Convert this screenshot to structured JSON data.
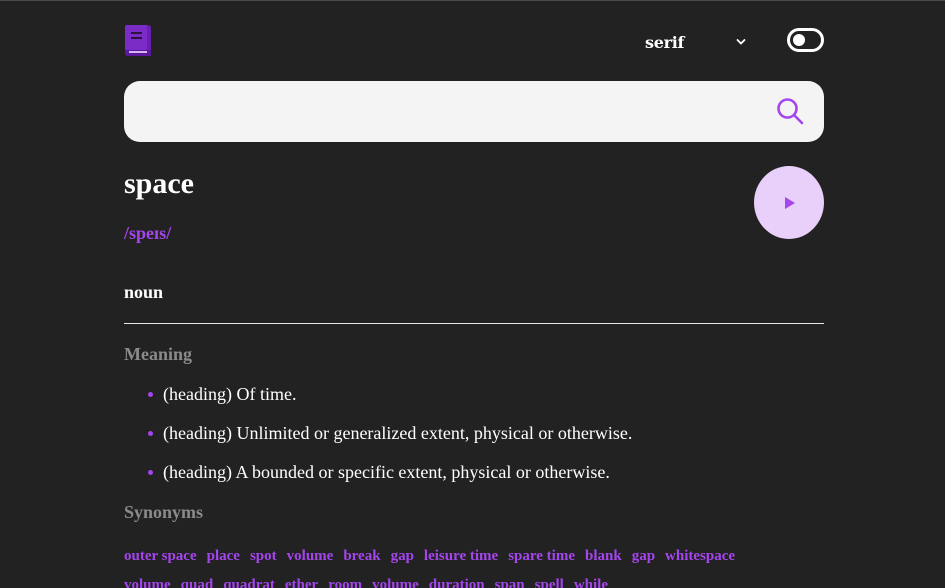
{
  "header": {
    "logo_icon": "book-icon",
    "font_select": {
      "selected": "serif",
      "icon": "chevron-down-icon"
    },
    "theme_toggle": {
      "state": "dark",
      "icon": "toggle-icon"
    }
  },
  "search": {
    "value": "",
    "placeholder": "",
    "icon": "search-icon"
  },
  "entry": {
    "word": "space",
    "phonetic": "/speɪs/",
    "play_icon": "play-icon",
    "part_of_speech": "noun",
    "meaning_heading": "Meaning",
    "meanings": [
      "(heading) Of time.",
      "(heading) Unlimited or generalized extent, physical or otherwise.",
      "(heading) A bounded or specific extent, physical or otherwise."
    ],
    "synonyms_heading": "Synonyms",
    "synonyms": [
      "outer space",
      "place",
      "spot",
      "volume",
      "break",
      "gap",
      "leisure time",
      "spare time",
      "blank",
      "gap",
      "whitespace",
      "volume",
      "quad",
      "quadrat",
      "ether",
      "room",
      "volume",
      "duration",
      "span",
      "spell",
      "while"
    ]
  },
  "colors": {
    "background": "#222222",
    "accent": "#a445ed",
    "play_button_bg": "#e9d0fa",
    "search_bg": "#f4f4f4",
    "muted_heading": "#8a8a8a"
  }
}
